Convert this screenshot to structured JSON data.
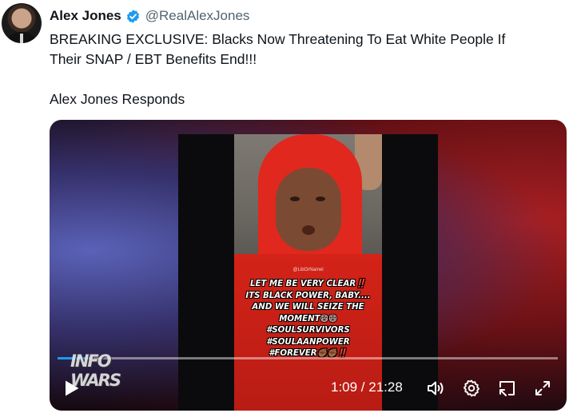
{
  "author": {
    "name": "Alex Jones",
    "handle": "@RealAlexJones",
    "verified_color": "#1d9bf0"
  },
  "tweet": {
    "line1": "BREAKING EXCLUSIVE: Blacks Now Threatening To Eat White People If",
    "line2": "Their SNAP / EBT Benefits End!!!",
    "line3": "Alex Jones Responds"
  },
  "video": {
    "watermark": "@LibOrNamel",
    "caption": "LET ME BE VERY CLEAR‼️\nITS BLACK POWER, BABY....\nAND WE WILL SEIZE THE\nMOMENT😄😄\n#SOULSURVIVORS\n#SOULAANPOWER\n#FOREVER✊🏾✊🏾‼️",
    "channel_logo": "INFO WARS",
    "current_time": "1:09",
    "total_time": "21:28",
    "time_display": "1:09 / 21:28",
    "progress_fraction": 0.054,
    "progress_color": "#1d9bf0"
  },
  "icons": {
    "play": "play-icon",
    "volume": "volume-icon",
    "settings": "gear-icon",
    "pip": "picture-in-picture-icon",
    "fullscreen": "fullscreen-icon"
  }
}
